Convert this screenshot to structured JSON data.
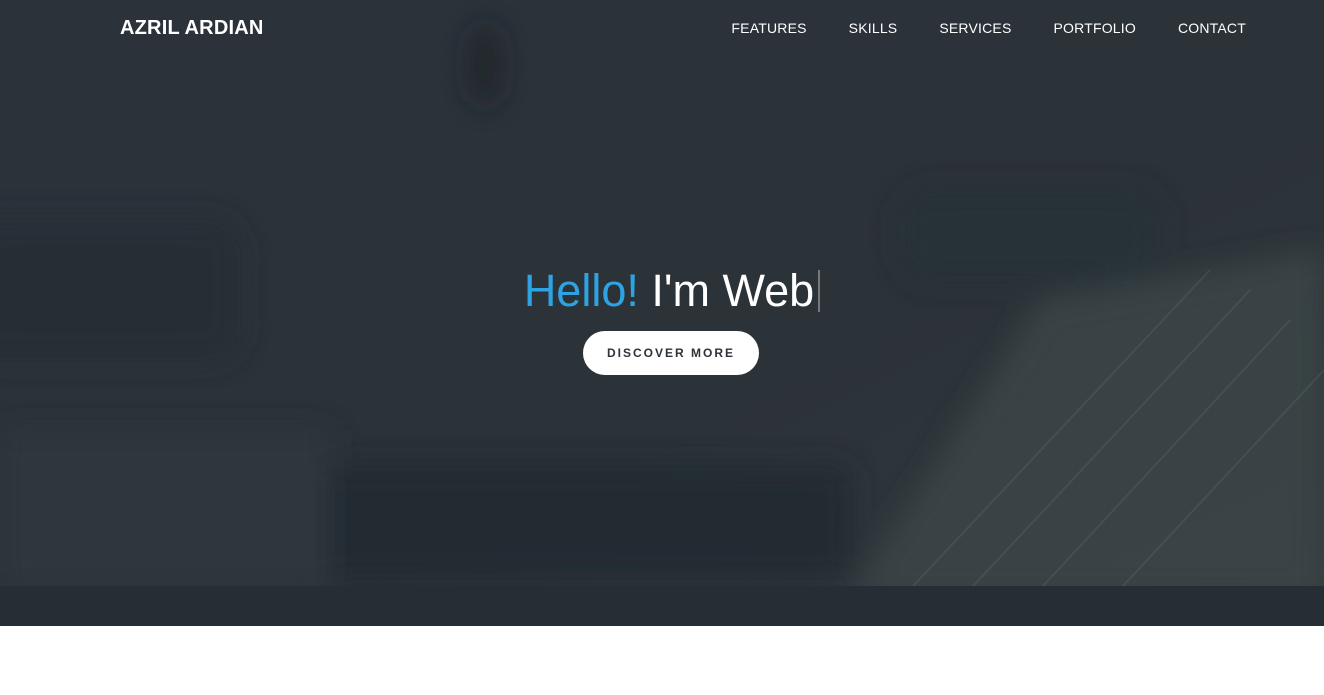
{
  "header": {
    "brand": "AZRIL ARDIAN",
    "nav": [
      {
        "label": "FEATURES"
      },
      {
        "label": "SKILLS"
      },
      {
        "label": "SERVICES"
      },
      {
        "label": "PORTFOLIO"
      },
      {
        "label": "CONTACT"
      }
    ]
  },
  "hero": {
    "greeting": "Hello!",
    "typed_text": "I'm Web",
    "cta_label": "DISCOVER MORE"
  },
  "colors": {
    "accent": "#2ea3e3",
    "overlay": "#2a3138",
    "button_bg": "#ffffff",
    "button_text": "#2d3338"
  }
}
